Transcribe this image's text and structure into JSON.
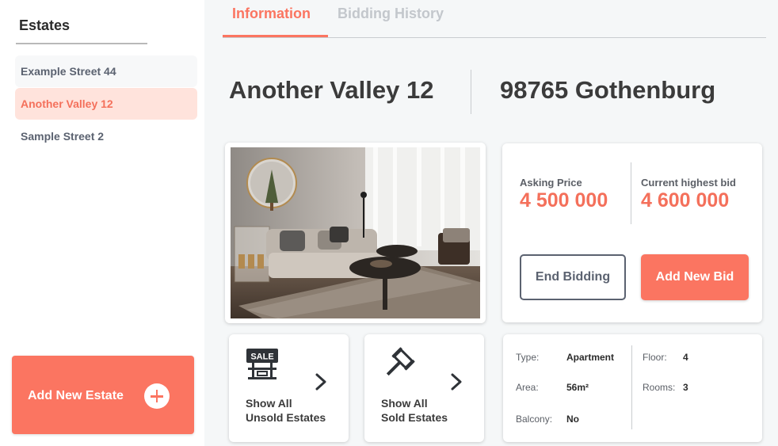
{
  "sidebar": {
    "title": "Estates",
    "items": [
      {
        "label": "Example Street 44"
      },
      {
        "label": "Another Valley 12"
      },
      {
        "label": "Sample Street 2"
      }
    ],
    "add_button_label": "Add New Estate"
  },
  "tabs": [
    {
      "label": "Information"
    },
    {
      "label": "Bidding History"
    }
  ],
  "estate": {
    "address": "Another Valley 12",
    "city": "98765 Gothenburg"
  },
  "pricing": {
    "asking_label": "Asking Price",
    "asking_value": "4 500 000",
    "highest_label": "Current highest bid",
    "highest_value": "4 600 000",
    "end_bidding_label": "End Bidding",
    "add_bid_label": "Add New Bid"
  },
  "nav_cards": [
    {
      "line1": "Show All",
      "line2": "Unsold Estates",
      "icon": "sale-sign-icon"
    },
    {
      "line1": "Show All",
      "line2": "Sold Estates",
      "icon": "gavel-icon"
    }
  ],
  "details": {
    "type_label": "Type:",
    "type_value": "Apartment",
    "area_label": "Area:",
    "area_value": "56m²",
    "balcony_label": "Balcony:",
    "balcony_value": "No",
    "floor_label": "Floor:",
    "floor_value": "4",
    "rooms_label": "Rooms:",
    "rooms_value": "3"
  },
  "sale_icon_text": "SALE",
  "colors": {
    "accent": "#fb7561",
    "accent_light": "#ffe3dc",
    "inactive_tab": "#c3c7cc",
    "background": "#f5f7f8"
  }
}
